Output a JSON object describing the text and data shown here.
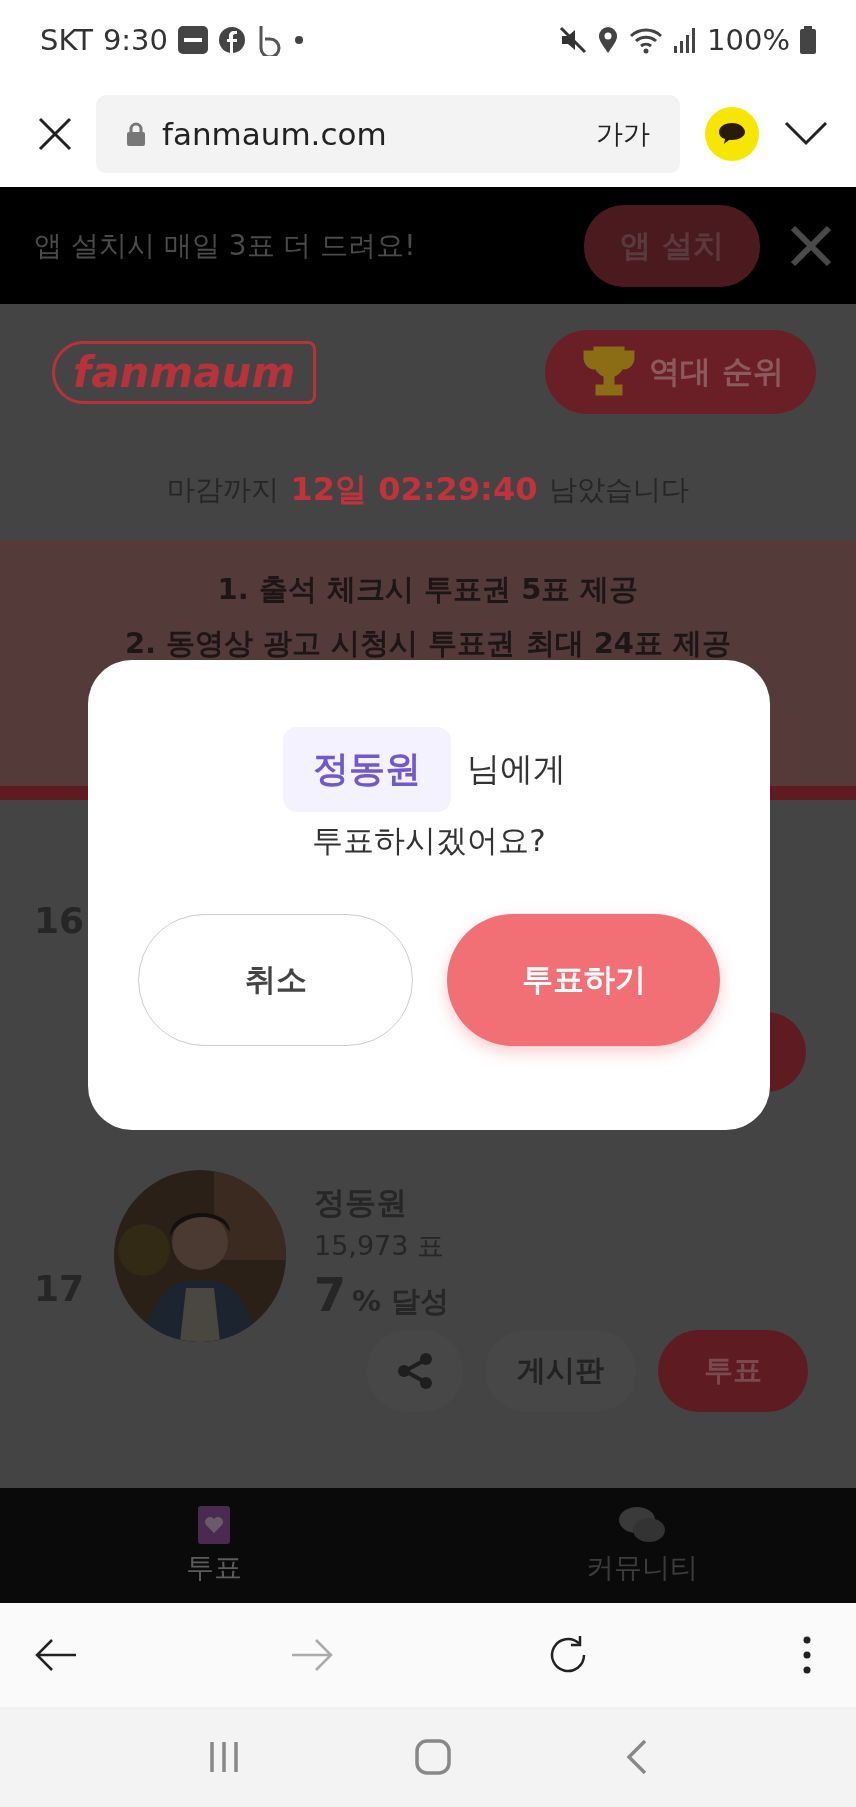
{
  "status_bar": {
    "carrier": "SKT",
    "time": "9:30",
    "battery": "100%"
  },
  "browser": {
    "url": "fanmaum.com",
    "text_size": "가가"
  },
  "banner": {
    "text": "앱 설치시 매일 3표 더 드려요!",
    "button": "앱 설치"
  },
  "header": {
    "logo": "fanmaum",
    "ranking_button": "역대 순위"
  },
  "countdown": {
    "prefix": "마감까지",
    "time": "12일 02:29:40",
    "suffix": "남았습니다"
  },
  "notice": [
    "1. 출석 체크시 투표권 5표 제공",
    "2. 동영상 광고 시청시 투표권 최대 24표 제공"
  ],
  "ranks": [
    {
      "rank": "16"
    },
    {
      "rank": "17",
      "name": "정동원",
      "votes": "15,973 표",
      "percent": "7",
      "percent_unit": "% 달성",
      "board": "게시판",
      "vote": "투표"
    }
  ],
  "dialog": {
    "name": "정동원",
    "suffix": "님에게",
    "question": "투표하시겠어요?",
    "cancel": "취소",
    "confirm": "투표하기"
  },
  "bottom_nav": [
    {
      "label": "투표",
      "selected": true
    },
    {
      "label": "커뮤니티",
      "selected": false
    }
  ]
}
